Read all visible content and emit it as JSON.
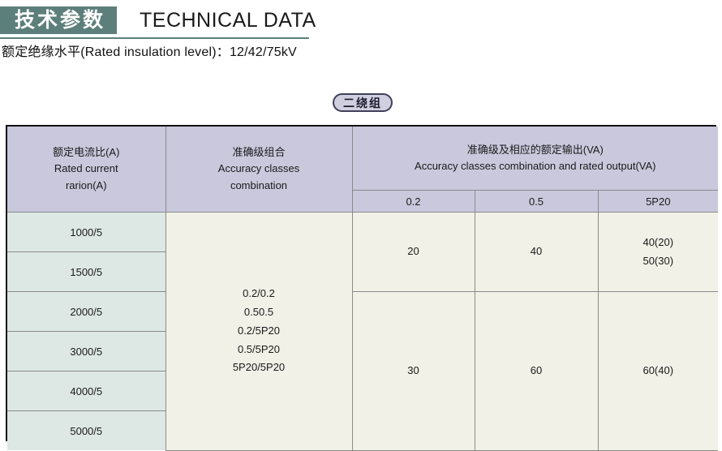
{
  "title": {
    "cn": "技术参数",
    "en": "TECHNICAL DATA"
  },
  "subtitle": "额定绝缘水平(Rated insulation level)：12/42/75kV",
  "group_badge": "二绕组",
  "colors": {
    "banner": "#5d7f7c",
    "header_fill": "#cac8dd",
    "ratio_fill": "#dde8e4",
    "body_fill": "#f1f1e8",
    "badge_fill": "#cfcfe0",
    "badge_border": "#40405a",
    "grid_line": "#8a8a8a",
    "frame": "#111111"
  },
  "table": {
    "headers": {
      "rated_current": {
        "cn": "额定电流比(A)",
        "en_line1": "Rated current",
        "en_line2": "rarion(A)"
      },
      "accuracy_combination": {
        "cn": "准确级组合",
        "en_line1": "Accuracy classes",
        "en_line2": "combination"
      },
      "output_group": {
        "cn": "准确级及相应的额定输出(VA)",
        "en": "Accuracy classes combination and rated output(VA)"
      },
      "sub_columns": [
        "0.2",
        "0.5",
        "5P20"
      ]
    },
    "ratios": [
      "1000/5",
      "1500/5",
      "2000/5",
      "3000/5",
      "4000/5",
      "5000/5"
    ],
    "accuracy_combination_lines": [
      "0.2/0.2",
      "0.50.5",
      "0.2/5P20",
      "0.5/5P20",
      "5P20/5P20"
    ],
    "output_groups": [
      {
        "row_span": 2,
        "values": {
          "c02": "20",
          "c05": "40",
          "c5p20_line1": "40(20)",
          "c5p20_line2": "50(30)"
        }
      },
      {
        "row_span": 4,
        "values": {
          "c02": "30",
          "c05": "60",
          "c5p20_line1": "60(40)",
          "c5p20_line2": ""
        }
      }
    ]
  }
}
